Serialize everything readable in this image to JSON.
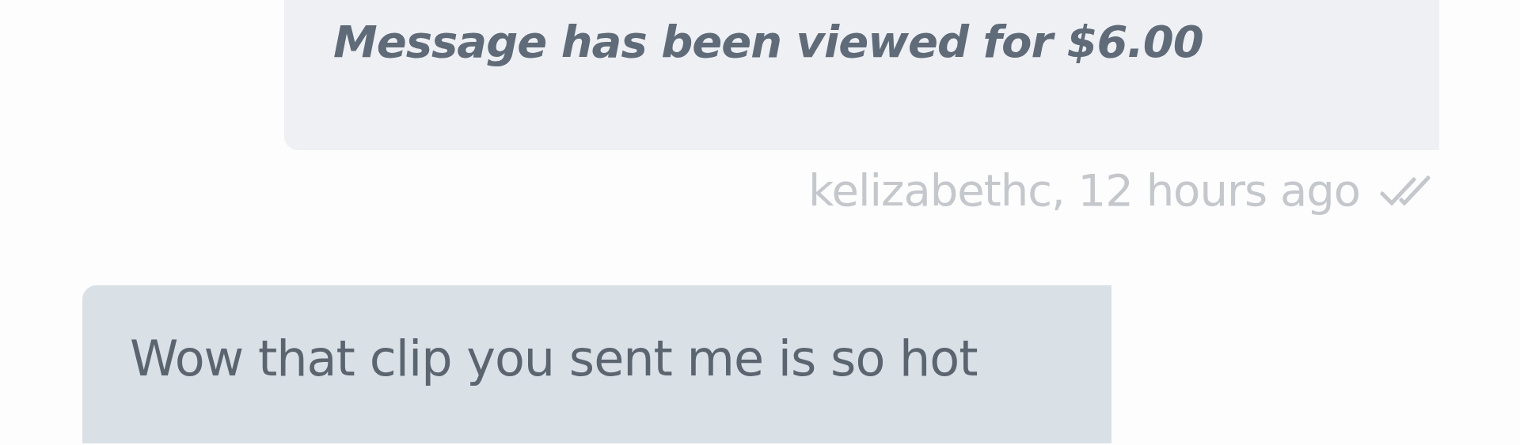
{
  "messages": [
    {
      "kind": "system",
      "text": "Message has been viewed for $6.00",
      "meta": "kelizabethc, 12 hours ago",
      "read": true
    },
    {
      "kind": "incoming",
      "text": "Wow that clip you sent me is so hot"
    }
  ]
}
